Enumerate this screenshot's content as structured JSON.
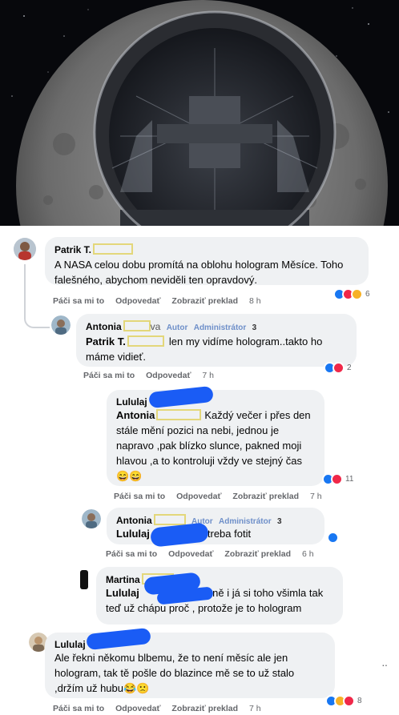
{
  "comments": [
    {
      "author": "Patrik T.",
      "text": "A NASA celou dobu promítá na oblohu hologram Měsíce. Toho falešného, abychom neviděli ten opravdový.",
      "actions": [
        "Páči sa mi to",
        "Odpovedať",
        "Zobraziť preklad"
      ],
      "time": "8 h",
      "reaction_count": "6"
    },
    {
      "author": "Antonia",
      "author_suffix": "va",
      "badges": [
        "Autor",
        "Administrátor",
        "3"
      ],
      "tag": "Patrik T.",
      "text": "len my vidíme hologram..takto ho máme vidieť.",
      "actions": [
        "Páči sa mi to",
        "Odpovedať"
      ],
      "time": "7 h",
      "reaction_count": "2"
    },
    {
      "author": "Lululaj",
      "tag": "Antonia",
      "text_after_tag": "Každý večer i přes",
      "text": "den stále mění pozici na nebi, jednou je napravo ,pak blízko slunce, pakned moji hlavou ,a to kontroluji vždy ve stejný čas 😄😄",
      "actions": [
        "Páči sa mi to",
        "Odpovedať",
        "Zobraziť preklad"
      ],
      "time": "7 h",
      "reaction_count": "11"
    },
    {
      "author": "Antonia",
      "badges": [
        "Autor",
        "Administrátor",
        "3"
      ],
      "tag": "Lululaj",
      "text": "treba fotit",
      "actions": [
        "Páči sa mi to",
        "Odpovedať",
        "Zobraziť preklad"
      ],
      "time": "6 h"
    },
    {
      "author": "Martina",
      "tag": "Lululaj",
      "text_after_tag": "přesně i já si toho všimla",
      "text": "tak teď už chápu proč , protože je to hologram"
    },
    {
      "author": "Lululaj",
      "text": "Ale řekni někomu blbemu, že to není měsíc ale jen hologram, tak tě pošle do blazince mě se to už stalo ,držím už hubu😂🙁",
      "actions": [
        "Páči sa mi to",
        "Odpovedať",
        "Zobraziť preklad"
      ],
      "time": "7 h",
      "reaction_count": "8"
    }
  ],
  "colors": {
    "bubble": "#eff1f3",
    "badge": "#6e8fc9",
    "redaction": "#1a5cf5",
    "like": "#1877f2",
    "love": "#f02849",
    "haha": "#f7b125"
  },
  "icons": [
    "moon-hologram-image",
    "like-icon",
    "love-icon",
    "haha-icon",
    "more-icon"
  ]
}
